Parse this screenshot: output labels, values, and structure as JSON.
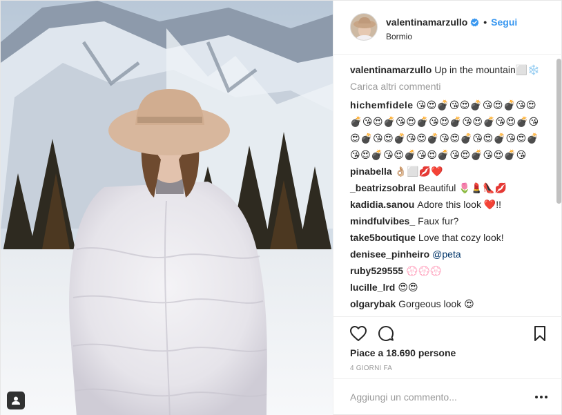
{
  "post": {
    "username": "valentinamarzullo",
    "follow_label": "Segui",
    "separator": "•",
    "location": "Bormio",
    "caption": "Up in the mountain⬜❄️"
  },
  "load_more_label": "Carica altri commenti",
  "comments": [
    {
      "user": "hichemfidele",
      "text": "😘😍💣😘😍💣😘😍💣😘😍💣😘😍💣😘😍💣😘😍💣😘😍💣😘😍💣😘😍💣😘😍💣😘😍💣😘😍💣😘😍💣😘😍💣😘😍💣😘😍💣😘😍💣😘😍💣😘😍💣😘"
    },
    {
      "user": "pinabella",
      "text": "👌🏼⬜💋❤️"
    },
    {
      "user": "_beatrizsobral",
      "text": "Beautiful 🌷💄👠💋"
    },
    {
      "user": "kadidia.sanou",
      "text": "Adore this look ❤️!!"
    },
    {
      "user": "mindfulvibes_",
      "text": "Faux fur?"
    },
    {
      "user": "take5boutique",
      "text": "Love that cozy look!"
    },
    {
      "user": "denisee_pinheiro",
      "text": "",
      "mention": "@peta"
    },
    {
      "user": "ruby529555",
      "text": "💮💮💮"
    },
    {
      "user": "lucille_lrd",
      "text": "😍😍"
    },
    {
      "user": "olgarybak",
      "text": "Gorgeous look 😍"
    }
  ],
  "likes_text": "Piace a 18.690 persone",
  "timestamp": "4 giorni fa",
  "add_comment_placeholder": "Aggiungi un commento...",
  "icons": {
    "like": "heart-icon",
    "comment": "comment-bubble-icon",
    "save": "bookmark-icon",
    "more": "more-options-icon",
    "verified": "verified-badge-icon",
    "tag": "user-tag-icon"
  },
  "colors": {
    "link_blue": "#3897f0",
    "text_dark": "#262626",
    "text_muted": "#999999",
    "border": "#efefef"
  }
}
